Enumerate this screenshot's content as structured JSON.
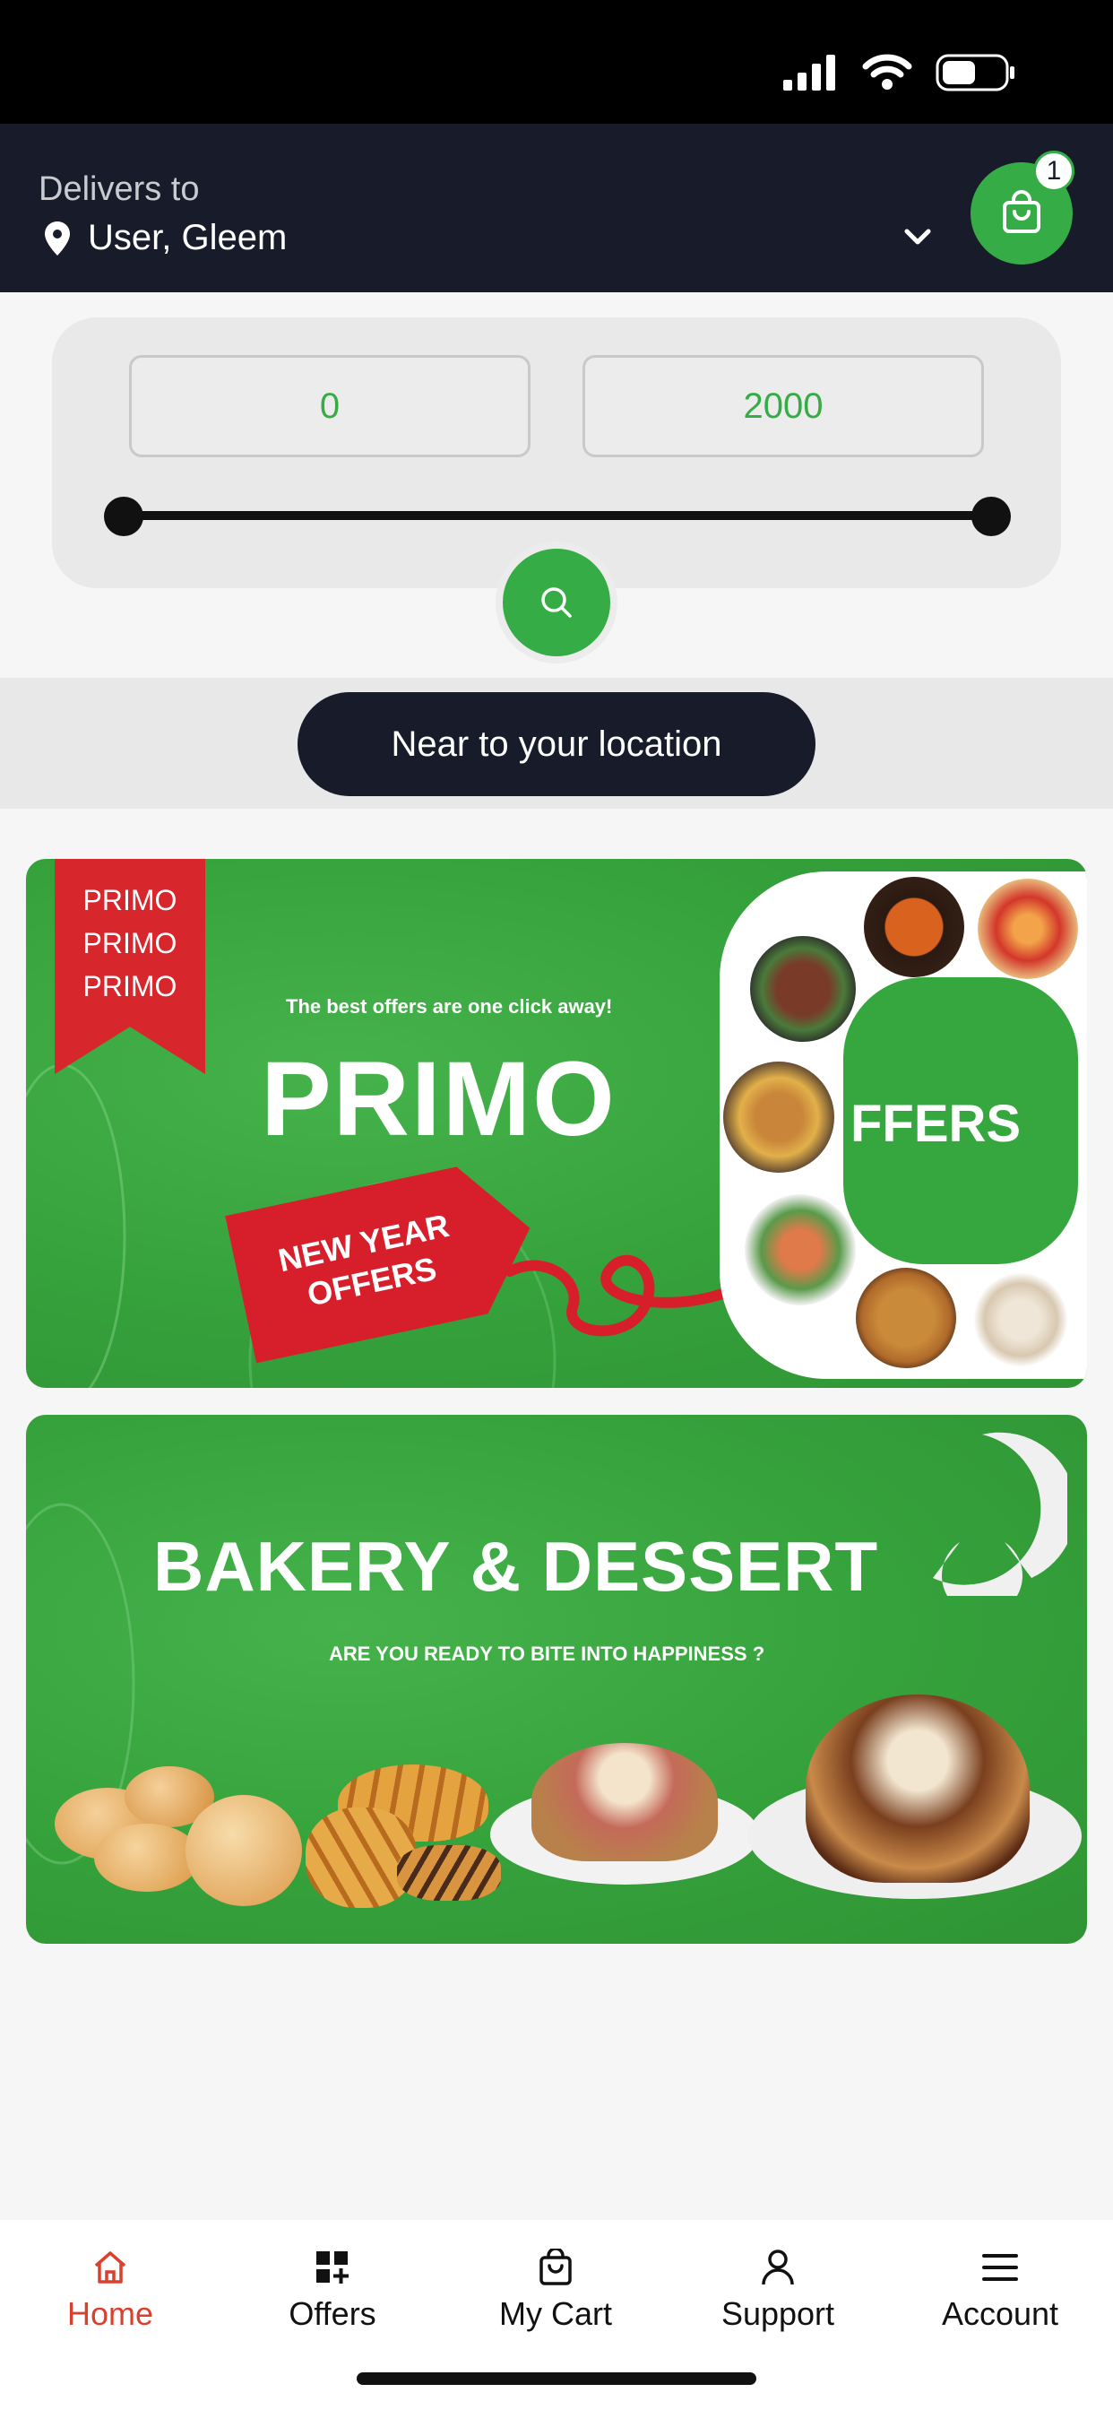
{
  "header": {
    "delivers_label": "Delivers to",
    "location": "User, Gleem",
    "cart_count": "1"
  },
  "filter": {
    "price_min": "0",
    "price_max": "2000",
    "range_min_fraction": 0,
    "range_max_fraction": 1
  },
  "near_button": "Near to your location",
  "banners": [
    {
      "ribbon": [
        "PRIMO",
        "PRIMO",
        "PRIMO"
      ],
      "tagline": "The best offers are one click away!",
      "headline": "PRIMO",
      "tag": [
        "NEW YEAR",
        "OFFERS"
      ],
      "side_word": "FFERS"
    },
    {
      "headline": "BAKERY & DESSERT",
      "subline": "ARE YOU READY TO BITE INTO HAPPINESS ?"
    }
  ],
  "tabs": [
    {
      "label": "Home",
      "icon": "home-icon",
      "active": true
    },
    {
      "label": "Offers",
      "icon": "offers-grid-icon"
    },
    {
      "label": "My Cart",
      "icon": "cart-bag-icon"
    },
    {
      "label": "Support",
      "icon": "person-icon"
    },
    {
      "label": "Account",
      "icon": "menu-icon"
    }
  ],
  "colors": {
    "accent_green": "#35ac45",
    "header_dark": "#181b2a",
    "active_tab": "#d9412e"
  }
}
